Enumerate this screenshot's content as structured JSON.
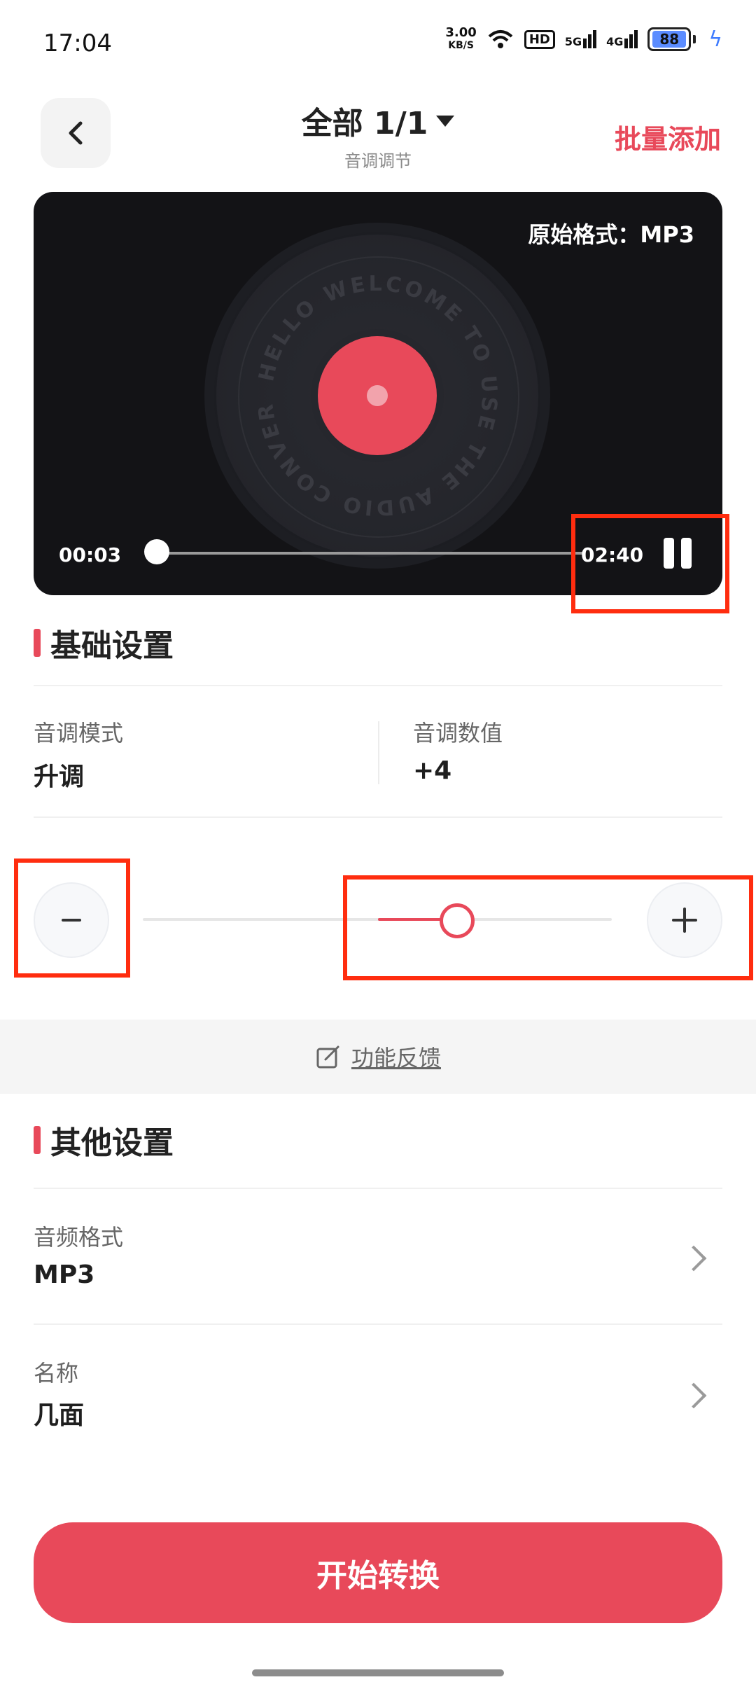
{
  "status_bar": {
    "time": "17:04",
    "net_speed_value": "3.00",
    "net_speed_unit": "KB/S",
    "hd_badge": "HD",
    "signal1": "5G",
    "signal2": "4G",
    "battery": "88"
  },
  "header": {
    "title": "全部 1/1",
    "subtitle": "音调调节",
    "batch_add": "批量添加"
  },
  "player": {
    "original_format": "原始格式：MP3",
    "disc_text": "HELLO WELCOME TO USE THE AUDIO CONVERTER",
    "current_time": "00:03",
    "total_time": "02:40",
    "progress_fraction": 0.02
  },
  "basic_settings": {
    "title": "基础设置",
    "pitch_mode_label": "音调模式",
    "pitch_mode_value": "升调",
    "pitch_value_label": "音调数值",
    "pitch_value": "+4",
    "slider_fraction": 0.66
  },
  "feedback": {
    "label": "功能反馈"
  },
  "other_settings": {
    "title": "其他设置",
    "audio_format_label": "音频格式",
    "audio_format_value": "MP3",
    "name_label": "名称",
    "name_value": "几面"
  },
  "start_button": "开始转换",
  "colors": {
    "accent": "#e8495a",
    "highlight_box": "#ff2d0f"
  }
}
